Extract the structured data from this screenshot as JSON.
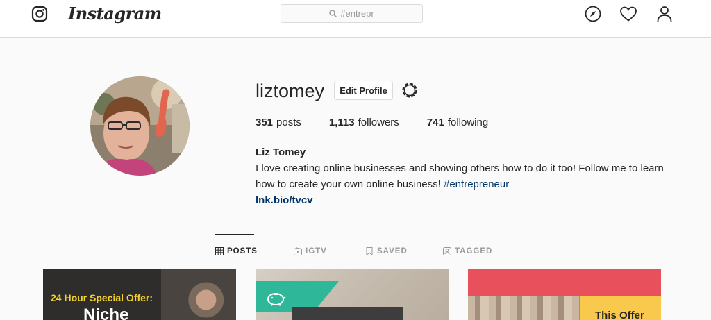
{
  "header": {
    "brand_name": "Instagram",
    "search_value": "#entrepr",
    "icons": [
      "instagram-glyph-icon",
      "search-icon",
      "compass-icon",
      "heart-icon",
      "person-icon"
    ]
  },
  "profile": {
    "username": "liztomey",
    "edit_button_label": "Edit Profile",
    "stats": {
      "posts_count": "351",
      "posts_label": "posts",
      "followers_count": "1,113",
      "followers_label": "followers",
      "following_count": "741",
      "following_label": "following"
    },
    "full_name": "Liz Tomey",
    "bio_text": "I love creating online businesses and showing others how to do it too! Follow me to learn how to create your own online business!",
    "bio_hashtag": "#entrepreneur",
    "link": "lnk.bio/tvcv"
  },
  "tabs": [
    {
      "label": "POSTS",
      "icon": "grid-icon",
      "active": true
    },
    {
      "label": "IGTV",
      "icon": "tv-icon",
      "active": false
    },
    {
      "label": "SAVED",
      "icon": "bookmark-icon",
      "active": false
    },
    {
      "label": "TAGGED",
      "icon": "tagged-person-icon",
      "active": false
    }
  ],
  "posts": [
    {
      "line1": "24 Hour Special Offer:",
      "line2": "Niche"
    },
    {
      "icon": "piggy-bank-icon"
    },
    {
      "text": "This Offer"
    }
  ],
  "colors": {
    "accent_link": "#003569",
    "border": "#dbdbdb",
    "post1_headline": "#f5d330",
    "post2_banner": "#2fb79a",
    "post3_background": "#e8505b",
    "post3_box": "#f9c94d"
  }
}
